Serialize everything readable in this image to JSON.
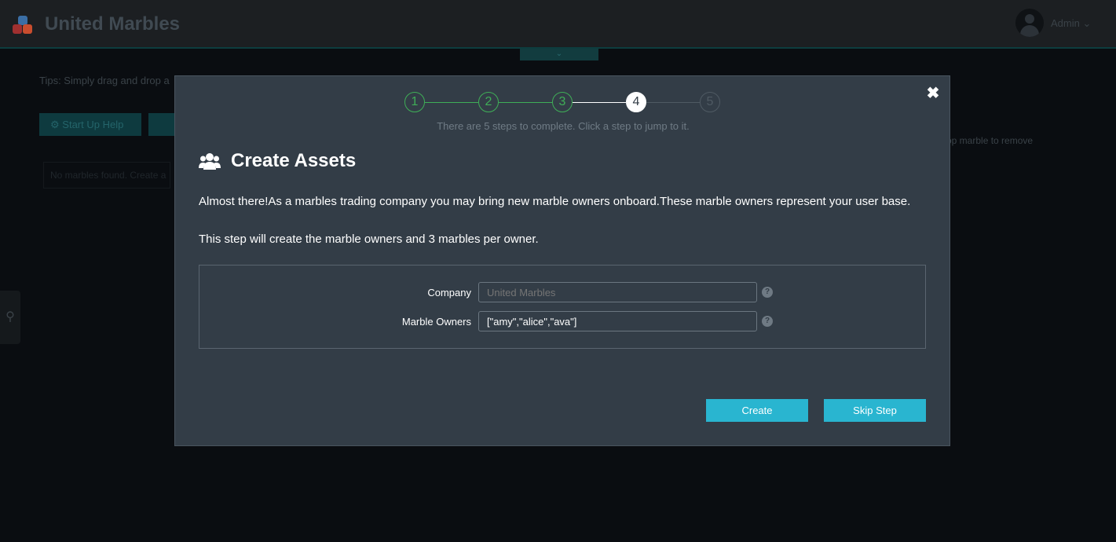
{
  "app": {
    "title": "United Marbles",
    "user_menu": "Admin ⌄"
  },
  "background": {
    "tips": "Tips: Simply drag and drop a",
    "startup_help_label": "Start Up Help",
    "panel_text": "No marbles found. Create a",
    "right_hint": "op marble to remove"
  },
  "modal": {
    "close_icon": "close-icon",
    "steps": [
      {
        "number": "1",
        "state": "done"
      },
      {
        "number": "2",
        "state": "done"
      },
      {
        "number": "3",
        "state": "done"
      },
      {
        "number": "4",
        "state": "active"
      },
      {
        "number": "5",
        "state": "todo"
      }
    ],
    "stepper_hint": "There are 5 steps to complete. Click a step to jump to it.",
    "title": "Create Assets",
    "paragraph1": "Almost there!As a marbles trading company you may bring new marble owners onboard.These marble owners represent your user base.",
    "paragraph2": "This step will create the marble owners and 3 marbles per owner.",
    "form": {
      "company_label": "Company",
      "company_placeholder": "United Marbles",
      "owners_label": "Marble Owners",
      "owners_value": "[\"amy\",\"alice\",\"ava\"]"
    },
    "create_label": "Create",
    "skip_label": "Skip Step"
  },
  "colors": {
    "modal_bg": "#333d47",
    "step_done": "#3fae57",
    "button": "#29b5d0",
    "page_bg": "#0a0d11"
  }
}
